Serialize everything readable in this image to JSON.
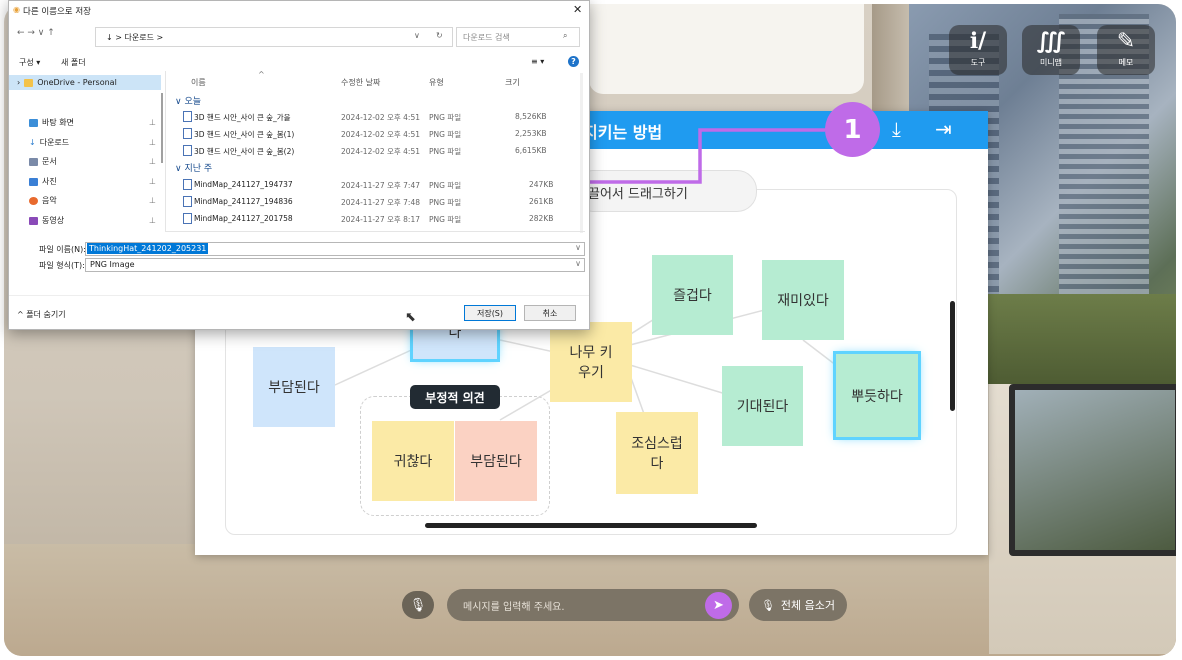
{
  "tools": [
    {
      "icon": "tool-icon",
      "glyph": "ℹ/",
      "label": "도구"
    },
    {
      "icon": "minimap-icon",
      "glyph": "∭",
      "label": "미니맵"
    },
    {
      "icon": "memo-icon",
      "glyph": "✎",
      "label": "메모"
    }
  ],
  "board": {
    "title": "지키는 방법",
    "drag_hint": "끌어서 드래그하기",
    "neg_label": "부정적 의견",
    "accent": "#1f9bf0"
  },
  "notes": {
    "burden_left": "부담된다",
    "top_partial": "다",
    "grow": "나무 키\n우기",
    "fun": "즐겁다",
    "interesting": "재미있다",
    "expect": "기대된다",
    "proud": "뿌듯하다",
    "careful": "조심스럽\n다",
    "annoying": "귀찮다",
    "burden_neg": "부담된다"
  },
  "callout": {
    "number": "1",
    "color": "#bf6be8"
  },
  "chat": {
    "placeholder": "메시지를 입력해 주세요.",
    "mute_all": "전체 음소거"
  },
  "dialog": {
    "title": "다른 이름으로 저장",
    "close": "✕",
    "nav": "←  →  ∨  ↑",
    "address": "↓  >  다운로드  >",
    "search_placeholder": "다운로드 검색",
    "organize": "구성 ▾",
    "new_folder": "새 폴더",
    "view": "≡ ▾",
    "help": "?",
    "sidebar": [
      {
        "label": "OneDrive - Personal",
        "color": "#f3c24a",
        "icon": "folder-icon"
      },
      {
        "label": "바탕 화면",
        "color": "#3b8ed8",
        "icon": "desktop-icon"
      },
      {
        "label": "다운로드",
        "color": "#2f7fd0",
        "icon": "download-icon"
      },
      {
        "label": "문서",
        "color": "#7a8aa8",
        "icon": "document-icon"
      },
      {
        "label": "사진",
        "color": "#3a7fd5",
        "icon": "pictures-icon"
      },
      {
        "label": "음악",
        "color": "#e86a2e",
        "icon": "music-icon"
      },
      {
        "label": "동영상",
        "color": "#8a4ab8",
        "icon": "video-icon"
      }
    ],
    "columns": [
      "이름",
      "수정한 날짜",
      "유형",
      "크기"
    ],
    "groups": [
      "오늘",
      "지난 주"
    ],
    "files_today": [
      {
        "name": "3D 핸드 시안_사이 큰 숲_가을",
        "date": "2024-12-02 오후 4:51",
        "type": "PNG 파일",
        "size": "8,526KB"
      },
      {
        "name": "3D 핸드 시안_사이 큰 숲_봄(1)",
        "date": "2024-12-02 오후 4:51",
        "type": "PNG 파일",
        "size": "2,253KB"
      },
      {
        "name": "3D 핸드 시안_사이 큰 숲_봄(2)",
        "date": "2024-12-02 오후 4:51",
        "type": "PNG 파일",
        "size": "6,615KB"
      }
    ],
    "files_week": [
      {
        "name": "MindMap_241127_194737",
        "date": "2024-11-27 오후 7:47",
        "type": "PNG 파일",
        "size": "247KB"
      },
      {
        "name": "MindMap_241127_194836",
        "date": "2024-11-27 오후 7:48",
        "type": "PNG 파일",
        "size": "261KB"
      },
      {
        "name": "MindMap_241127_201758",
        "date": "2024-11-27 오후 8:17",
        "type": "PNG 파일",
        "size": "282KB"
      }
    ],
    "filename_label": "파일 이름(N):",
    "filename_value": "ThinkingHat_241202_205231",
    "filetype_label": "파일 형식(T):",
    "filetype_value": "PNG Image",
    "hide_folders": "폴더 숨기기",
    "save": "저장(S)",
    "cancel": "취소"
  }
}
